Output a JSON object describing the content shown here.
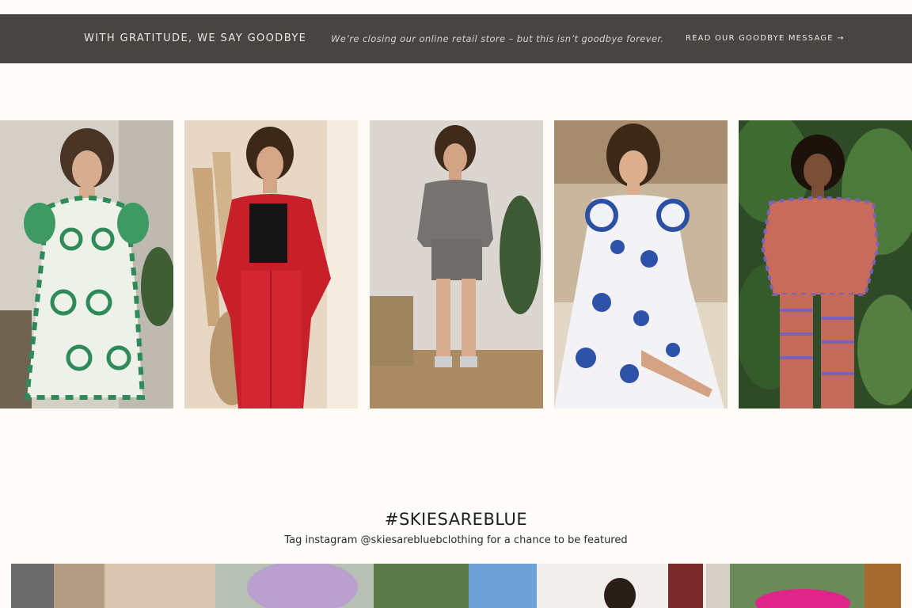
{
  "announcement": {
    "left_text": "WITH GRATITUDE, WE SAY GOODBYE",
    "middle_text": "We’re closing our online retail store – but this isn’t goodbye forever.",
    "link_text": "READ OUR GOODBYE MESSAGE →"
  },
  "gallery": {
    "items": [
      {
        "name": "green-printed-dress-photo"
      },
      {
        "name": "red-blazer-set-photo"
      },
      {
        "name": "gray-jacket-shorts-photo"
      },
      {
        "name": "blue-floral-dress-photo"
      },
      {
        "name": "pink-printed-set-photo"
      }
    ]
  },
  "instagram": {
    "hashtag": "#SKIESAREBLUE",
    "tagline": "Tag instagram @skiesarebluebclothing for a chance to be featured"
  }
}
